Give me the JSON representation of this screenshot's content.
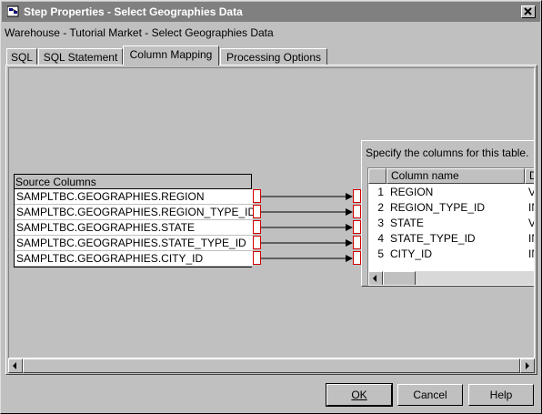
{
  "window": {
    "title": "Step Properties - Select Geographies Data",
    "subtitle": "Warehouse - Tutorial Market - Select Geographies Data",
    "title_icon": "step-properties-icon",
    "close_icon": "close-icon"
  },
  "tabs": [
    {
      "label": "SQL",
      "active": false
    },
    {
      "label": "SQL Statement",
      "active": false
    },
    {
      "label": "Column Mapping",
      "active": true
    },
    {
      "label": "Processing Options",
      "active": false
    }
  ],
  "source": {
    "header": "Source Columns",
    "columns": [
      "SAMPLTBC.GEOGRAPHIES.REGION",
      "SAMPLTBC.GEOGRAPHIES.REGION_TYPE_ID",
      "SAMPLTBC.GEOGRAPHIES.STATE",
      "SAMPLTBC.GEOGRAPHIES.STATE_TYPE_ID",
      "SAMPLTBC.GEOGRAPHIES.CITY_ID"
    ]
  },
  "target": {
    "caption": "Specify the columns for this table.",
    "headers": {
      "name": "Column name",
      "type": "D"
    },
    "rows": [
      {
        "num": "1",
        "name": "REGION",
        "type": "V/"
      },
      {
        "num": "2",
        "name": "REGION_TYPE_ID",
        "type": "IN"
      },
      {
        "num": "3",
        "name": "STATE",
        "type": "V/"
      },
      {
        "num": "4",
        "name": "STATE_TYPE_ID",
        "type": "IN"
      },
      {
        "num": "5",
        "name": "CITY_ID",
        "type": "IN"
      }
    ]
  },
  "buttons": {
    "ok": "OK",
    "cancel": "Cancel",
    "help": "Help"
  },
  "colors": {
    "title_bar": "#808080",
    "connector_border": "#d00000",
    "background": "#c0c0c0"
  }
}
